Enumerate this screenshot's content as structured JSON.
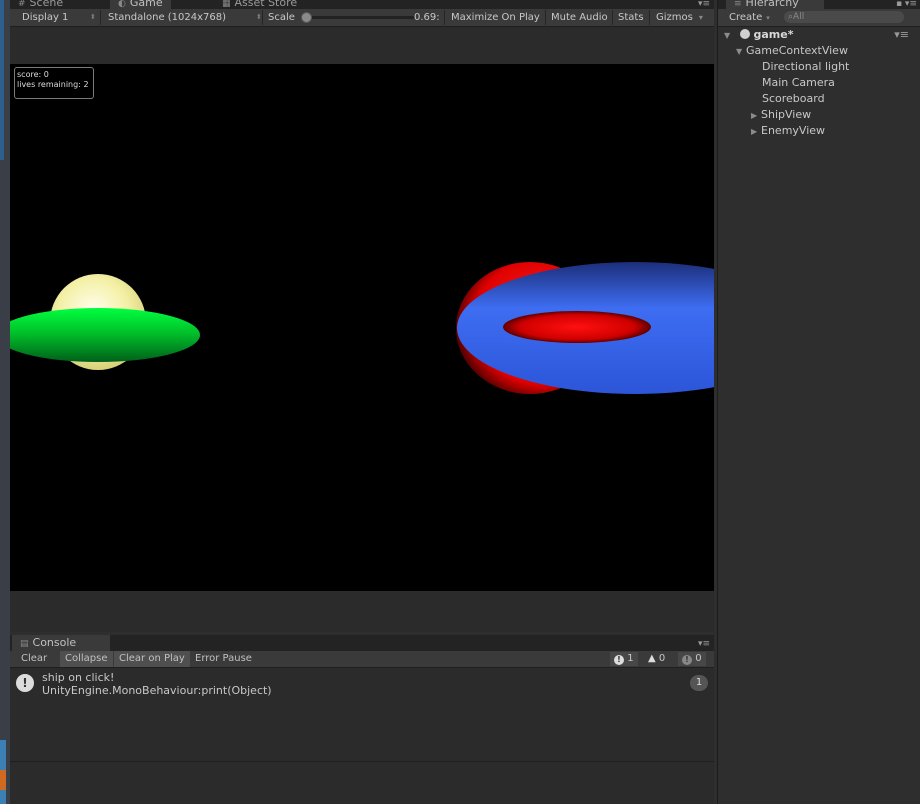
{
  "game": {
    "tabs": [
      {
        "label": "Scene",
        "icon": "scene-icon"
      },
      {
        "label": "Game",
        "icon": "game-icon"
      },
      {
        "label": "Asset Store",
        "icon": "store-icon"
      }
    ],
    "toolbar": {
      "display": "Display 1",
      "resolution": "Standalone (1024x768)",
      "scale_label": "Scale",
      "scale_value": "0.69:",
      "maximize": "Maximize On Play",
      "mute": "Mute Audio",
      "stats": "Stats",
      "gizmos": "Gizmos"
    },
    "overlay": {
      "score": "score: 0",
      "lives": "lives remaining: 2"
    }
  },
  "hierarchy": {
    "tab": "Hierarchy",
    "create": "Create",
    "search_placeholder": "All",
    "scene_name": "game*",
    "items": [
      {
        "label": "GameContextView",
        "expanded": true
      },
      {
        "label": "Directional light"
      },
      {
        "label": "Main Camera"
      },
      {
        "label": "Scoreboard"
      },
      {
        "label": "ShipView",
        "collapsed": true
      },
      {
        "label": "EnemyView",
        "collapsed": true
      }
    ]
  },
  "console": {
    "tab": "Console",
    "buttons": {
      "clear": "Clear",
      "collapse": "Collapse",
      "clear_on_play": "Clear on Play",
      "error_pause": "Error Pause"
    },
    "counts": {
      "info": "1",
      "warn": "0",
      "error": "0"
    },
    "log": {
      "line1": "ship on click!",
      "line2": "UnityEngine.MonoBehaviour:print(Object)",
      "count": "1"
    }
  },
  "colors": {
    "ship_green": "#00c22a",
    "ship_dome": "#f4f0a6",
    "enemy_blue": "#3e6df2",
    "enemy_red": "#ff0000",
    "panel_bg": "#2b2b2b"
  }
}
